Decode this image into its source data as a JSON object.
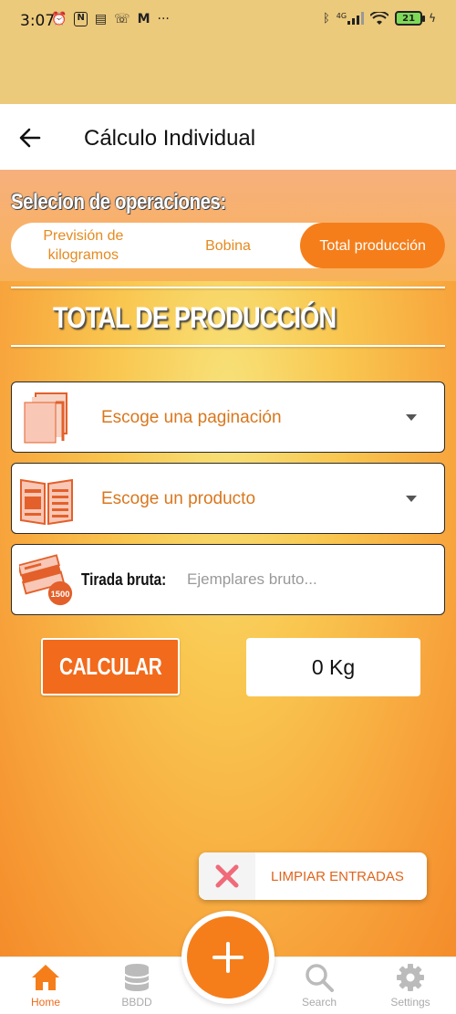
{
  "status_bar": {
    "time": "3:07",
    "left_icons": [
      "alarm-icon",
      "nfc-icon",
      "news-icon",
      "call-icon",
      "gmail-icon",
      "more-icon"
    ],
    "network": "4G",
    "battery": "21"
  },
  "app_bar": {
    "title": "Cálculo Individual",
    "back_icon": "arrow-left-icon"
  },
  "operations": {
    "label": "Selecion de operaciones:",
    "tabs": [
      {
        "label": "Previsión de kilogramos",
        "active": false
      },
      {
        "label": "Bobina",
        "active": false
      },
      {
        "label": "Total producción",
        "active": true
      }
    ]
  },
  "section": {
    "title": "TOTAL DE PRODUCCIÓN"
  },
  "form": {
    "pagination": {
      "placeholder": "Escoge una paginación",
      "icon": "pages-icon"
    },
    "product": {
      "placeholder": "Escoge un producto",
      "icon": "open-book-icon"
    },
    "tirada": {
      "label": "Tirada bruta:",
      "placeholder": "Ejemplares bruto...",
      "value": "",
      "icon": "stack-1500-icon",
      "badge": "1500"
    }
  },
  "actions": {
    "calculate_label": "CALCULAR",
    "result": "0 Kg",
    "clear_label": "LIMPIAR ENTRADAS"
  },
  "bottom_nav": [
    {
      "label": "Home",
      "icon": "home-icon",
      "active": true
    },
    {
      "label": "BBDD",
      "icon": "database-icon",
      "active": false
    },
    {
      "label": "Search",
      "icon": "search-icon",
      "active": false
    },
    {
      "label": "Settings",
      "icon": "gear-icon",
      "active": false
    }
  ],
  "colors": {
    "accent": "#f57e1a",
    "status_bar_bg": "#ecca7b",
    "field_text": "#d9771d"
  }
}
